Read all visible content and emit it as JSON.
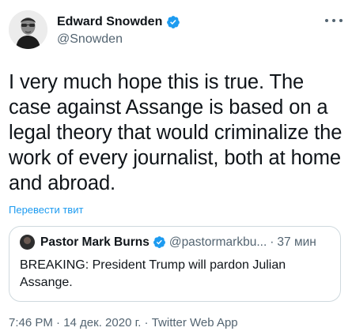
{
  "tweet": {
    "author": {
      "name": "Edward Snowden",
      "handle": "@Snowden"
    },
    "text": "I very much hope this is true. The case against Assange is based on a legal theory that would criminalize the work of every journalist, both at home and abroad.",
    "translate_label": "Перевести твит",
    "quote": {
      "name": "Pastor Mark Burns",
      "handle": "@pastormarkbu...",
      "separator": "·",
      "time": "37 мин",
      "text": "BREAKING: President Trump will pardon Julian Assange."
    },
    "meta": "7:46 PM · 14 дек. 2020 г. · Twitter Web App"
  },
  "icons": {
    "verified": "verified-badge-icon",
    "more": "more-options-icon"
  },
  "colors": {
    "accent": "#1d9bf0",
    "text": "#0f1419",
    "secondary": "#536471",
    "border": "#cfd9de"
  }
}
